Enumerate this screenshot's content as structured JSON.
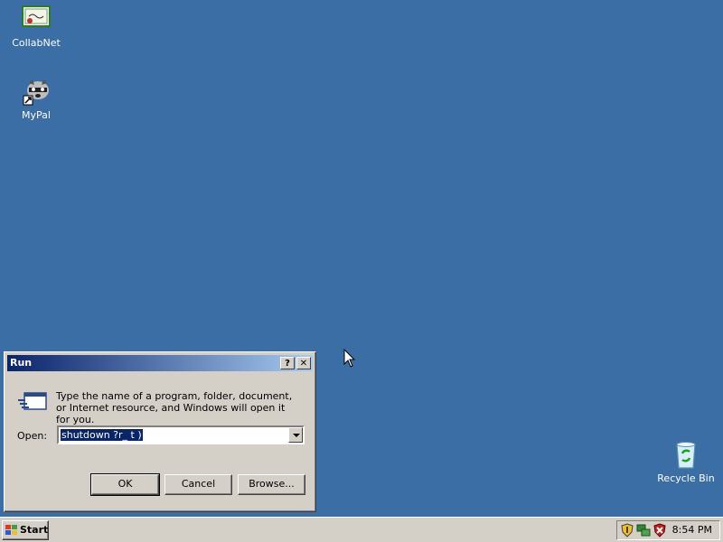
{
  "desktop": {
    "icons": [
      {
        "label": "CollabNet",
        "icon": "certificate-icon"
      },
      {
        "label": "MyPal",
        "icon": "raccoon-icon"
      },
      {
        "label": "Recycle Bin",
        "icon": "recycle-bin-icon"
      }
    ]
  },
  "run_dialog": {
    "title": "Run",
    "help_button": "?",
    "close_button": "✕",
    "description": "Type the name of a program, folder, document, or Internet resource, and Windows will open it for you.",
    "open_label": "Open:",
    "open_value": "shutdown ?r_ t )",
    "ok_label": "OK",
    "cancel_label": "Cancel",
    "browse_label": "Browse..."
  },
  "taskbar": {
    "start_label": "Start",
    "clock": "8:54 PM",
    "tray_icons": [
      "shield-icon",
      "network-icon",
      "security-alert-icon"
    ]
  }
}
